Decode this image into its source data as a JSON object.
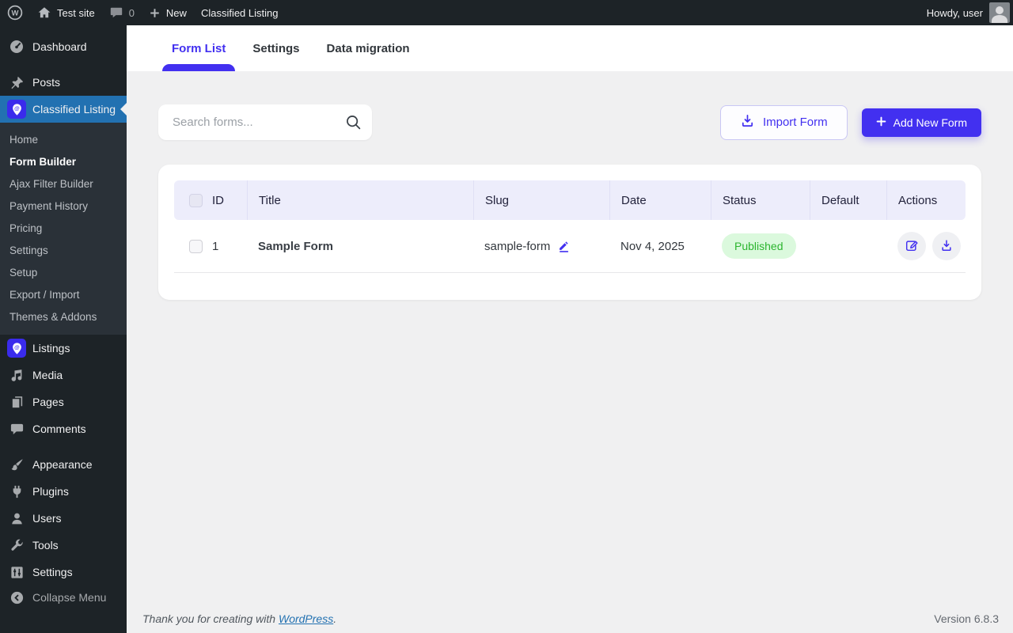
{
  "accent_color": "#4230f0",
  "highlight_color": "#2271b1",
  "admin_bar": {
    "site_name": "Test site",
    "comment_count": "0",
    "new_label": "New",
    "current_page": "Classified Listing",
    "howdy": "Howdy, user"
  },
  "sidebar": {
    "top": [
      {
        "label": "Dashboard",
        "icon": "dashboard-icon"
      },
      {
        "label": "Posts",
        "icon": "posts-icon"
      }
    ],
    "active_item": {
      "label": "Classified Listing",
      "icon": "classified-listing-icon"
    },
    "submenu": [
      {
        "label": "Home",
        "current": false
      },
      {
        "label": "Form Builder",
        "current": true
      },
      {
        "label": "Ajax Filter Builder",
        "current": false
      },
      {
        "label": "Payment History",
        "current": false
      },
      {
        "label": "Pricing",
        "current": false
      },
      {
        "label": "Settings",
        "current": false
      },
      {
        "label": "Setup",
        "current": false
      },
      {
        "label": "Export / Import",
        "current": false
      },
      {
        "label": "Themes & Addons",
        "current": false
      }
    ],
    "middle": [
      {
        "label": "Listings",
        "icon": "listings-icon"
      },
      {
        "label": "Media",
        "icon": "media-icon"
      },
      {
        "label": "Pages",
        "icon": "pages-icon"
      },
      {
        "label": "Comments",
        "icon": "comments-icon"
      }
    ],
    "bottom": [
      {
        "label": "Appearance",
        "icon": "appearance-icon"
      },
      {
        "label": "Plugins",
        "icon": "plugins-icon"
      },
      {
        "label": "Users",
        "icon": "users-icon"
      },
      {
        "label": "Tools",
        "icon": "tools-icon"
      },
      {
        "label": "Settings",
        "icon": "settings-icon"
      }
    ],
    "collapse": {
      "label": "Collapse Menu",
      "icon": "collapse-icon"
    }
  },
  "tabs": [
    {
      "label": "Form List",
      "active": true
    },
    {
      "label": "Settings",
      "active": false
    },
    {
      "label": "Data migration",
      "active": false
    }
  ],
  "toolbar": {
    "search_placeholder": "Search forms...",
    "search_value": "",
    "import_label": "Import Form",
    "add_label": "Add New Form"
  },
  "table": {
    "headers": [
      "ID",
      "Title",
      "Slug",
      "Date",
      "Status",
      "Default",
      "Actions"
    ],
    "rows": [
      {
        "id": "1",
        "title": "Sample Form",
        "slug": "sample-form",
        "date": "Nov 4, 2025",
        "status": "Published",
        "status_color": "#2cb52f",
        "status_bg": "#dbf9dd",
        "default_on": true,
        "actions": [
          "edit-icon",
          "export-icon"
        ]
      }
    ]
  },
  "footer": {
    "thanks_prefix": "Thank you for creating with ",
    "wordpress_link": "WordPress",
    "thanks_suffix": ".",
    "version": "Version 6.8.3"
  }
}
